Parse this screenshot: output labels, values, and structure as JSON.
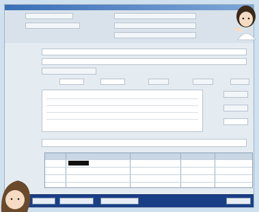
{
  "window": {
    "title": ""
  },
  "header": {
    "row1_left_label": "",
    "row1_left_value": "",
    "row1_right_label": "",
    "row1_right_value": "",
    "row2_left_label": "",
    "row2_left_value": "",
    "row2_right_label": "",
    "row2_right_value": "",
    "row3_right_label": "",
    "row3_right_value": ""
  },
  "form": {
    "name_label": "",
    "sub_label": "",
    "type_label": "",
    "type_value": "",
    "detail_label": "",
    "remarks_label": "",
    "remarks_value": "",
    "table_label": ""
  },
  "table": {
    "columns": [
      "",
      "",
      "",
      "",
      ""
    ],
    "first_cell": ""
  },
  "buttons": {
    "b1": "",
    "b2": "",
    "b3": "",
    "b4": ""
  },
  "colors": {
    "titlebar": "#3a6fb7",
    "statusbar": "#1a3f86",
    "background": "#cfe0ee"
  }
}
